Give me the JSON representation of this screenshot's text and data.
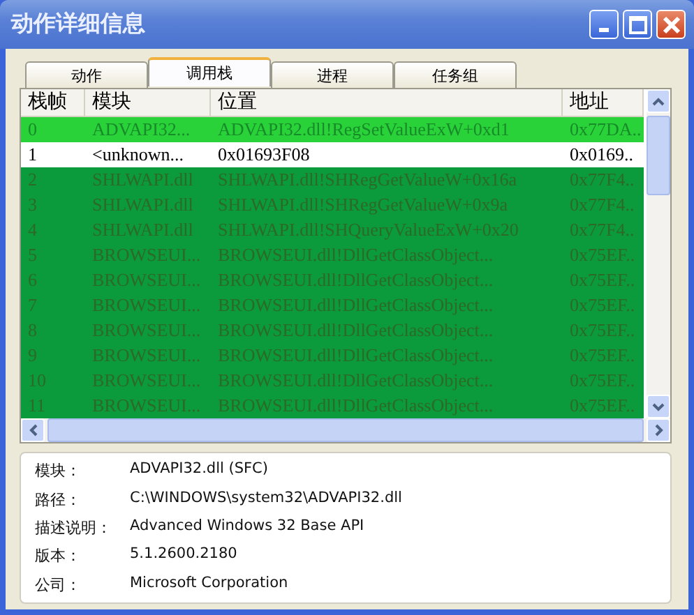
{
  "window": {
    "title": "动作详细信息"
  },
  "tabs": [
    {
      "label": "动作",
      "selected": false
    },
    {
      "label": "调用栈",
      "selected": true
    },
    {
      "label": "进程",
      "selected": false
    },
    {
      "label": "任务组",
      "selected": false
    }
  ],
  "table": {
    "columns": [
      "栈帧",
      "模块",
      "位置",
      "地址"
    ],
    "rows": [
      {
        "cells": [
          "0",
          "ADVAPI32...",
          "ADVAPI32.dll!RegSetValueExW+0xd1",
          "0x77DA.."
        ],
        "selected": true,
        "highlighted": true
      },
      {
        "cells": [
          "1",
          "<unknown...",
          "0x01693F08",
          "0x0169.."
        ],
        "selected": false,
        "highlighted": false
      },
      {
        "cells": [
          "2",
          "SHLWAPI.dll",
          "SHLWAPI.dll!SHRegGetValueW+0x16a",
          "0x77F4.."
        ],
        "selected": false,
        "highlighted": true
      },
      {
        "cells": [
          "3",
          "SHLWAPI.dll",
          "SHLWAPI.dll!SHRegGetValueW+0x9a",
          "0x77F4.."
        ],
        "selected": false,
        "highlighted": true
      },
      {
        "cells": [
          "4",
          "SHLWAPI.dll",
          "SHLWAPI.dll!SHQueryValueExW+0x20",
          "0x77F4.."
        ],
        "selected": false,
        "highlighted": true
      },
      {
        "cells": [
          "5",
          "BROWSEUI...",
          "BROWSEUI.dll!DllGetClassObject...",
          "0x75EF.."
        ],
        "selected": false,
        "highlighted": true
      },
      {
        "cells": [
          "6",
          "BROWSEUI...",
          "BROWSEUI.dll!DllGetClassObject...",
          "0x75EF.."
        ],
        "selected": false,
        "highlighted": true
      },
      {
        "cells": [
          "7",
          "BROWSEUI...",
          "BROWSEUI.dll!DllGetClassObject...",
          "0x75EF.."
        ],
        "selected": false,
        "highlighted": true
      },
      {
        "cells": [
          "8",
          "BROWSEUI...",
          "BROWSEUI.dll!DllGetClassObject...",
          "0x75EF.."
        ],
        "selected": false,
        "highlighted": true
      },
      {
        "cells": [
          "9",
          "BROWSEUI...",
          "BROWSEUI.dll!DllGetClassObject...",
          "0x75EF.."
        ],
        "selected": false,
        "highlighted": true
      },
      {
        "cells": [
          "10",
          "BROWSEUI...",
          "BROWSEUI.dll!DllGetClassObject...",
          "0x75EF.."
        ],
        "selected": false,
        "highlighted": true
      },
      {
        "cells": [
          "11",
          "BROWSEUI...",
          "BROWSEUI.dll!DllGetClassObject...",
          "0x75EF.."
        ],
        "selected": false,
        "highlighted": true
      }
    ]
  },
  "details": [
    {
      "label": "模块：",
      "value": "ADVAPI32.dll (SFC)"
    },
    {
      "label": "路径：",
      "value": "C:\\WINDOWS\\system32\\ADVAPI32.dll"
    },
    {
      "label": "描述说明：",
      "value": "Advanced Windows 32 Base API"
    },
    {
      "label": "版本：",
      "value": "5.1.2600.2180"
    },
    {
      "label": "公司：",
      "value": "Microsoft Corporation"
    }
  ]
}
